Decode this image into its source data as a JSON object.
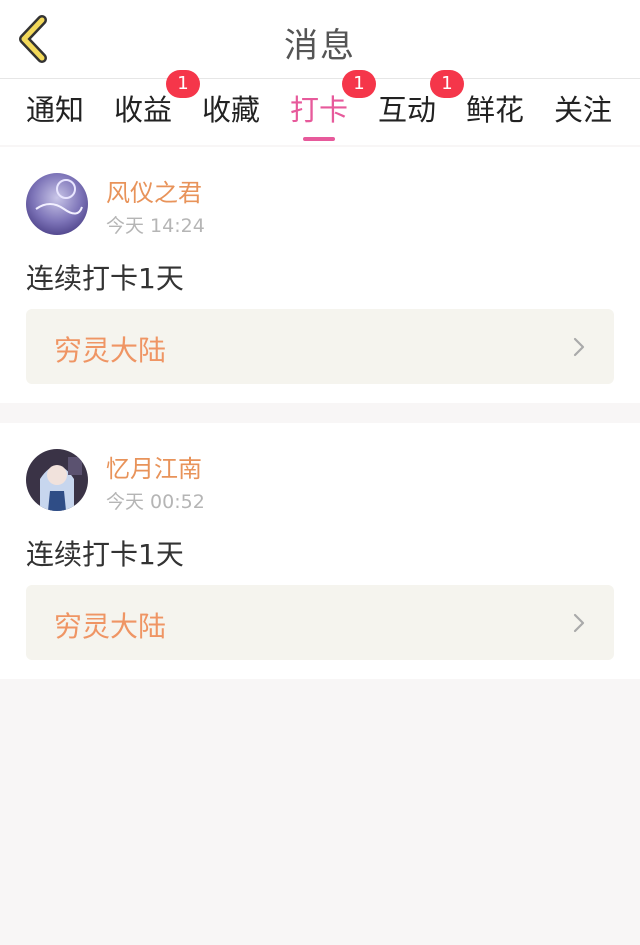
{
  "header": {
    "title": "消息"
  },
  "tabs": [
    {
      "label": "通知",
      "badge": ""
    },
    {
      "label": "收益",
      "badge": "1"
    },
    {
      "label": "收藏",
      "badge": ""
    },
    {
      "label": "打卡",
      "badge": "1",
      "active": true
    },
    {
      "label": "互动",
      "badge": "1"
    },
    {
      "label": "鲜花",
      "badge": ""
    },
    {
      "label": "关注",
      "badge": ""
    }
  ],
  "items": [
    {
      "user": "风仪之君",
      "time": "今天 14:24",
      "message": "连续打卡1天",
      "book": "穷灵大陆"
    },
    {
      "user": "忆月江南",
      "time": "今天 00:52",
      "message": "连续打卡1天",
      "book": "穷灵大陆"
    }
  ],
  "colors": {
    "accent": "#e75a9b",
    "username": "#e8935a",
    "book": "#ef9564",
    "badge": "#f5364a"
  }
}
